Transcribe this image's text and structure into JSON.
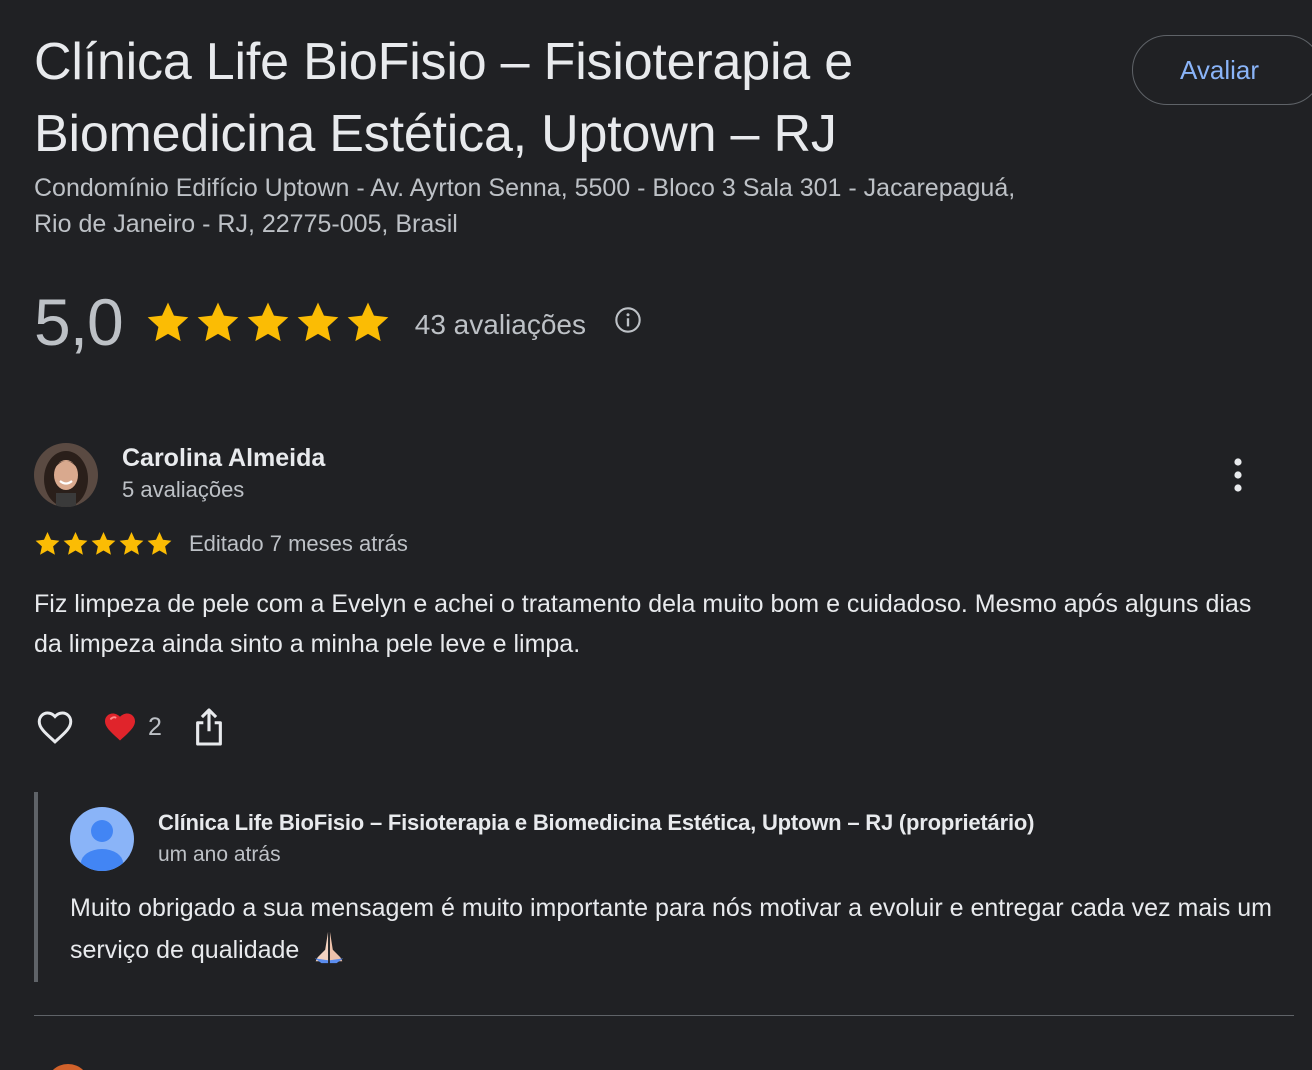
{
  "business": {
    "title": "Clínica Life BioFisio – Fisioterapia e Biomedicina Estética, Uptown – RJ",
    "address": "Condomínio Edifício Uptown - Av. Ayrton Senna, 5500 - Bloco 3 Sala 301 - Jacarepaguá, Rio de Janeiro - RJ, 22775-005, Brasil",
    "rate_button_label": "Avaliar"
  },
  "rating_summary": {
    "score": "5,0",
    "stars": 5,
    "total_label": "43 avaliações",
    "icon": "info-icon"
  },
  "review": {
    "reviewer_name": "Carolina Almeida",
    "reviewer_reviews": "5 avaliações",
    "stars": 5,
    "edited_label": "Editado 7 meses atrás",
    "text": "Fiz limpeza de pele com a Evelyn e achei o tratamento dela muito bom e cuidadoso. Mesmo após alguns dias da limpeza ainda sinto a minha pele leve e limpa.",
    "heart_reaction_count": "2",
    "icons": [
      "heart-outline-icon",
      "red-heart-icon",
      "share-icon",
      "more-vert-icon"
    ]
  },
  "owner_reply": {
    "name": "Clínica Life BioFisio – Fisioterapia e Biomedicina Estética, Uptown – RJ (proprietário)",
    "time": "um ano atrás",
    "text": "Muito obrigado a sua mensagem é muito importante para nós motivar a evoluir e entregar cada vez mais um serviço de qualidade",
    "emoji": "🙏🏻"
  },
  "colors": {
    "background": "#202124",
    "text_primary": "#e8eaed",
    "text_secondary": "#bdc1c6",
    "star": "#fbbc04",
    "link_accent": "#8ab4f8",
    "owner_avatar": "#8ab4f8"
  }
}
